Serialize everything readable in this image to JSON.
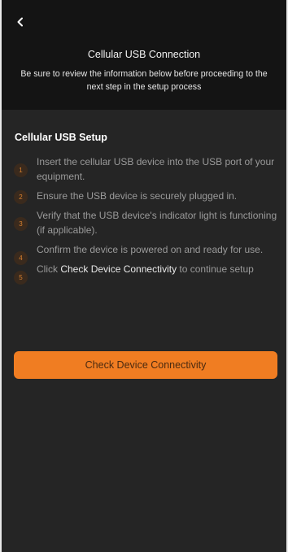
{
  "header": {
    "back_icon": "chevron-left-icon",
    "title": "Cellular USB Connection",
    "subtitle": "Be sure to review the information below before proceeding to the next step in the setup process"
  },
  "setup": {
    "title": "Cellular USB Setup",
    "steps": [
      {
        "number": "1",
        "text": "Insert the cellular USB device into the USB port of your equipment."
      },
      {
        "number": "2",
        "text": "Ensure the USB device is securely plugged in."
      },
      {
        "number": "3",
        "text": "Verify that the USB device's indicator light is functioning (if applicable)."
      },
      {
        "number": "4",
        "text": "Confirm the device is powered on and ready for use."
      },
      {
        "number": "5",
        "text_before": "Click ",
        "highlight": "Check Device Connectivity",
        "text_after": " to continue setup"
      }
    ]
  },
  "actions": {
    "check_connectivity_label": "Check Device Connectivity"
  },
  "colors": {
    "accent": "#f07d22",
    "header_bg": "#141414",
    "body_bg": "#252525"
  }
}
